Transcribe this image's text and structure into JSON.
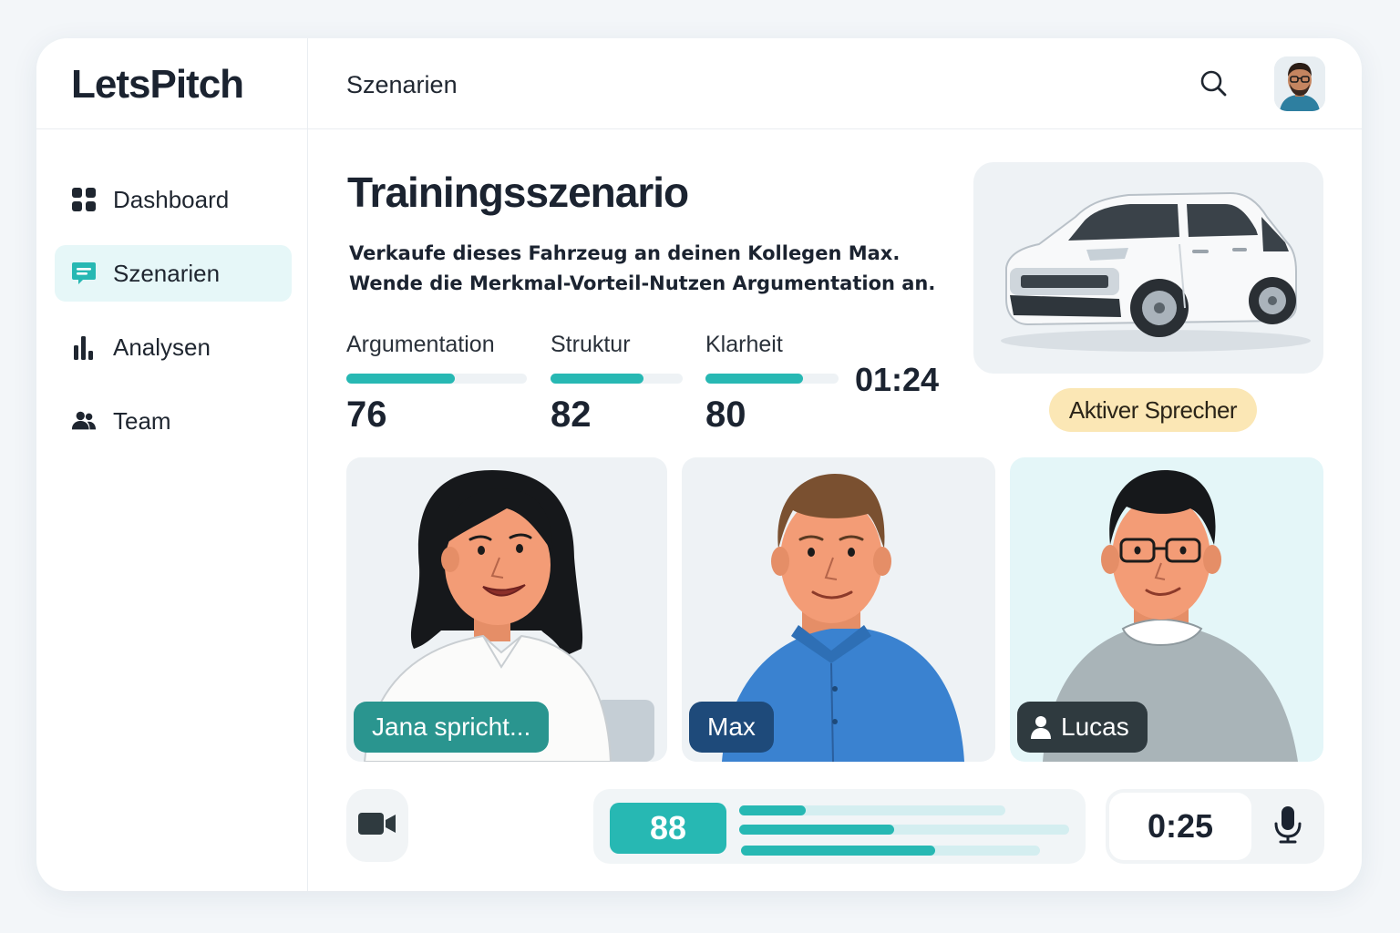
{
  "app": {
    "logo": "LetsPitch"
  },
  "sidebar": {
    "items": [
      {
        "label": "Dashboard",
        "icon": "grid-icon",
        "active": false
      },
      {
        "label": "Szenarien",
        "icon": "chat-icon",
        "active": true
      },
      {
        "label": "Analysen",
        "icon": "bar-chart-icon",
        "active": false
      },
      {
        "label": "Team",
        "icon": "users-icon",
        "active": false
      }
    ]
  },
  "header": {
    "title": "Szenarien",
    "search_icon": "search-icon",
    "avatar": "user-avatar"
  },
  "main": {
    "title": "Trainingsszenario",
    "description_line1": "Verkaufe dieses Fahrzeug an deinen Kollegen Max.",
    "description_line2": "Wende die Merkmal-Vorteil-Nutzen Argumentation an.",
    "metrics": [
      {
        "label": "Argumentation",
        "value": "76",
        "progress": 0.6
      },
      {
        "label": "Struktur",
        "value": "82",
        "progress": 0.7
      },
      {
        "label": "Klarheit",
        "value": "80",
        "progress": 0.73
      }
    ],
    "timer": "01:24",
    "active_speaker_badge": "Aktiver Sprecher"
  },
  "participants": [
    {
      "label": "Jana spricht...",
      "name": "Jana"
    },
    {
      "label": "Max",
      "name": "Max"
    },
    {
      "label": "Lucas",
      "name": "Lucas",
      "icon": "person-icon"
    }
  ],
  "bottom_bar": {
    "camera_icon": "video-camera-icon",
    "score": "88",
    "score_bars": [
      0.25,
      0.47,
      0.65
    ],
    "countdown": "0:25",
    "mic_icon": "microphone-icon"
  },
  "colors": {
    "accent": "#27b8b3",
    "active_nav_bg": "#e6f7f8",
    "badge_bg": "#fbe7b5",
    "jana_label": "#2a958f",
    "max_label": "#1e4a7a",
    "lucas_label": "#2f3a3f"
  }
}
